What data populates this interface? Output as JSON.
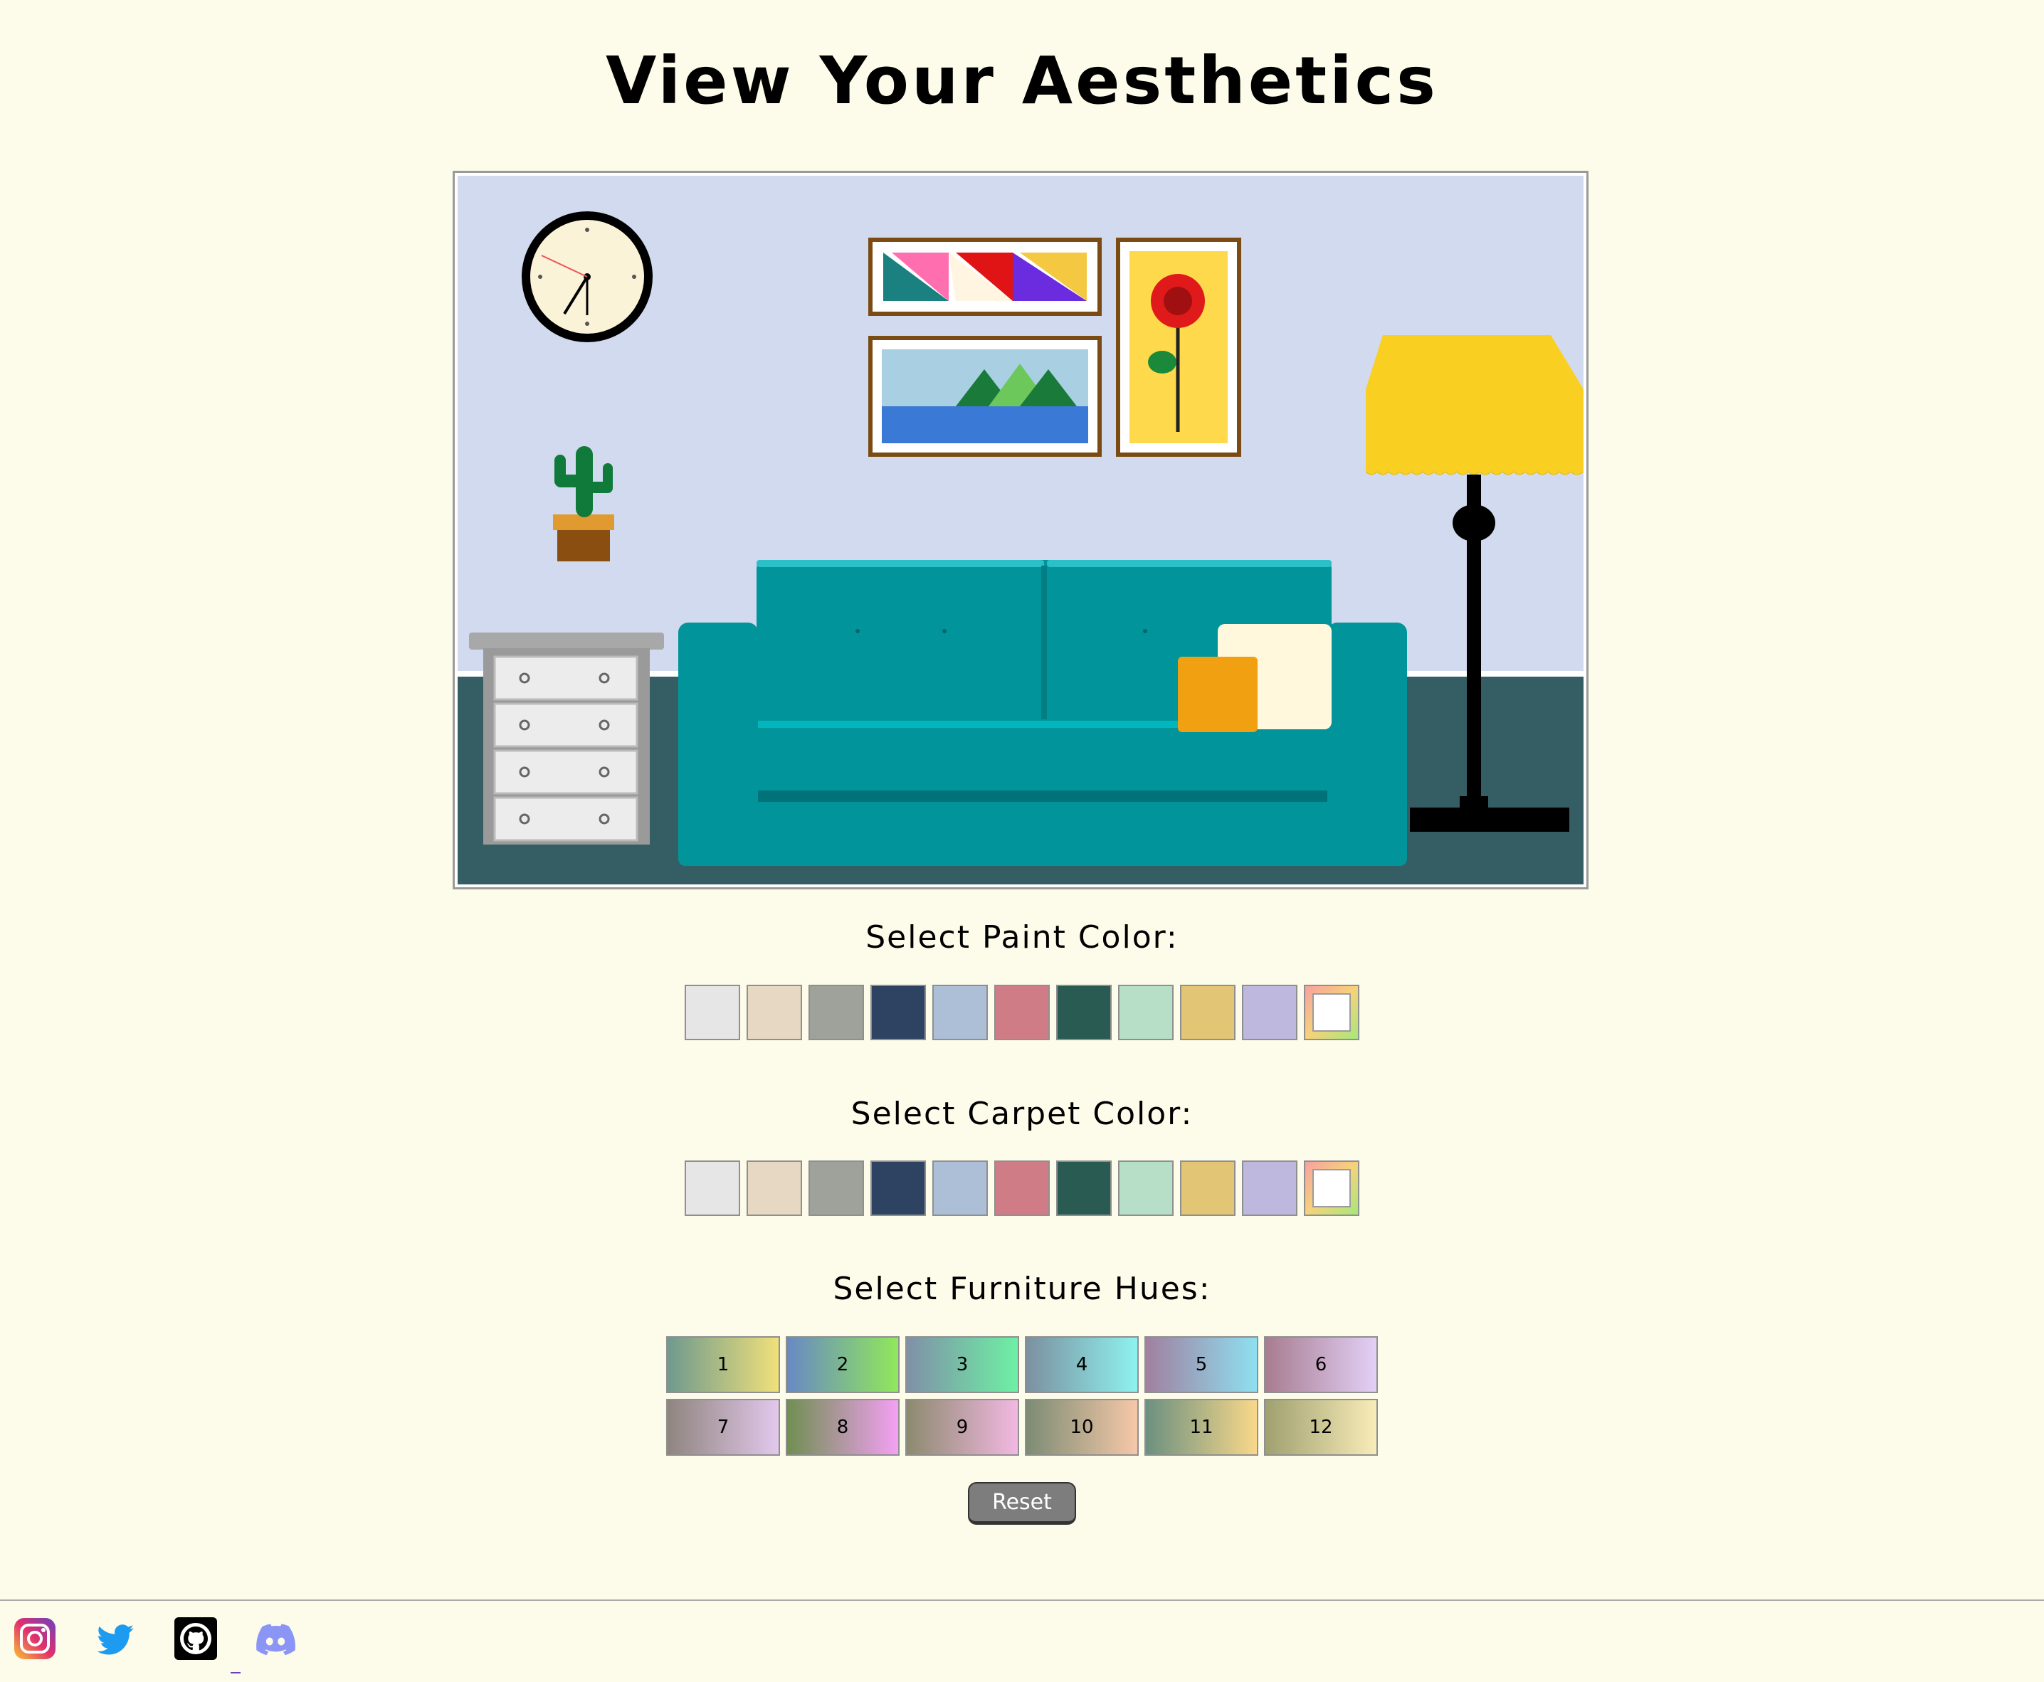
{
  "title": "View Your Aesthetics",
  "scene": {
    "wall_color": "#d1daee",
    "floor_color": "#345e64",
    "sofa_color": "#01959b",
    "lamp_shade_color": "#f9d021"
  },
  "paint": {
    "label": "Select Paint Color:",
    "swatches": [
      "#e6e6e6",
      "#e6d8c2",
      "#9fa29a",
      "#2d4361",
      "#acbfd7",
      "#cf7c87",
      "#295b52",
      "#b7dec7",
      "#e2c675",
      "#beb8df",
      "custom"
    ]
  },
  "carpet": {
    "label": "Select Carpet Color:",
    "swatches": [
      "#e6e6e6",
      "#e6d8c2",
      "#9fa29a",
      "#2d4361",
      "#acbfd7",
      "#cf7c87",
      "#295b52",
      "#b7dec7",
      "#e2c675",
      "#beb8df",
      "custom"
    ]
  },
  "furniture": {
    "label": "Select Furniture Hues:",
    "hues": [
      {
        "label": "1",
        "from": "#6f9a8e",
        "to": "#f0e07a"
      },
      {
        "label": "2",
        "from": "#6889c4",
        "to": "#91e85a"
      },
      {
        "label": "3",
        "from": "#8090a8",
        "to": "#6ef0a4"
      },
      {
        "label": "4",
        "from": "#7c90a0",
        "to": "#8ef2ee"
      },
      {
        "label": "5",
        "from": "#a080a0",
        "to": "#8ee0f0"
      },
      {
        "label": "6",
        "from": "#a87c90",
        "to": "#e2d0f6"
      },
      {
        "label": "7",
        "from": "#8f857f",
        "to": "#e2c8ec"
      },
      {
        "label": "8",
        "from": "#6f8f50",
        "to": "#f4a0f4"
      },
      {
        "label": "9",
        "from": "#8c8a6e",
        "to": "#f2b8e2"
      },
      {
        "label": "10",
        "from": "#7c8c74",
        "to": "#f6c8a8"
      },
      {
        "label": "11",
        "from": "#6c9080",
        "to": "#f8d88a"
      },
      {
        "label": "12",
        "from": "#a0a070",
        "to": "#f8ecb8"
      }
    ]
  },
  "reset_label": "Reset",
  "footer": {
    "icons": [
      "instagram-icon",
      "twitter-icon",
      "github-icon",
      "discord-icon"
    ]
  }
}
